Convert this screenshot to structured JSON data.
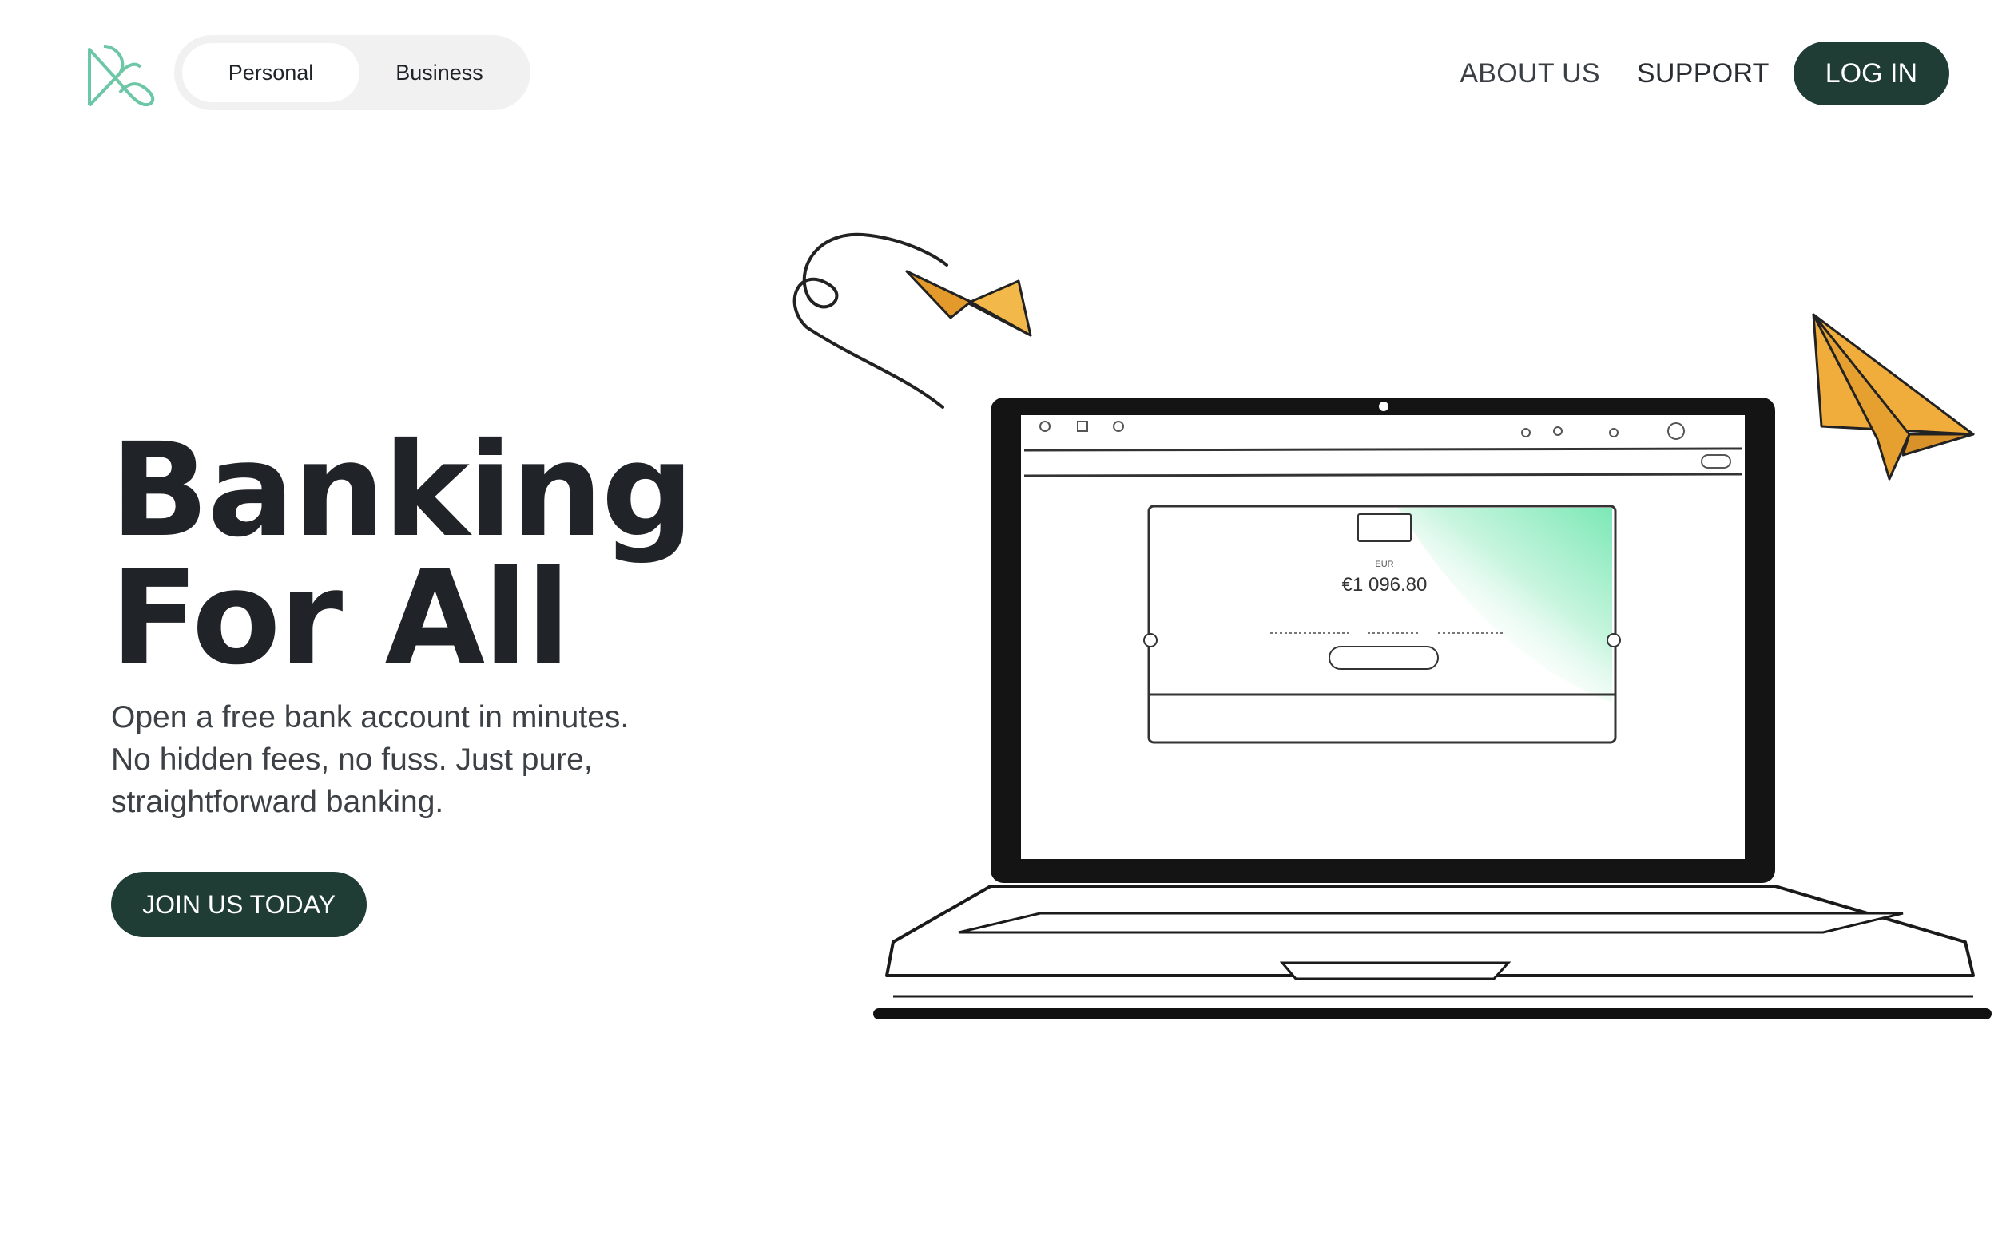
{
  "header": {
    "logo_icon": "brand-logo-icon",
    "account_type": {
      "options": [
        "Personal",
        "Business"
      ],
      "selected": "Personal"
    },
    "nav": {
      "about": "ABOUT US",
      "support": "SUPPORT",
      "login": "LOG IN"
    }
  },
  "hero": {
    "title_line1": "Banking",
    "title_line2": "For All",
    "subtitle_line1": "Open a free bank account in minutes.",
    "subtitle_line2": "No hidden fees, no fuss. Just pure,",
    "subtitle_line3": "straightforward banking.",
    "cta": "JOIN US TODAY"
  },
  "illustration": {
    "screen_currency": "EUR",
    "screen_balance": "€1 096.80"
  },
  "colors": {
    "brand_dark": "#1f3c35",
    "brand_green": "#6cc7a6",
    "plane_orange": "#f0ad3c",
    "card_gradient": "#7ce8b6"
  }
}
